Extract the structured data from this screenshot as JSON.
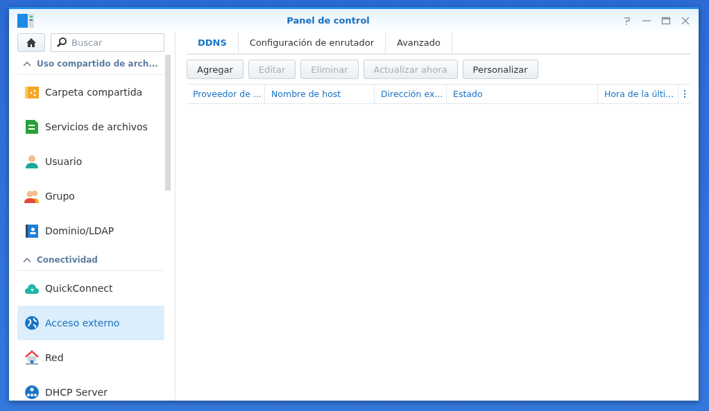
{
  "window": {
    "title": "Panel de control"
  },
  "sidebar": {
    "search": {
      "placeholder": "Buscar"
    },
    "groups": [
      {
        "title": "Uso compartido de arch...",
        "expanded": true,
        "items": [
          {
            "label": "Carpeta compartida",
            "selected": false
          },
          {
            "label": "Servicios de archivos",
            "selected": false
          },
          {
            "label": "Usuario",
            "selected": false
          },
          {
            "label": "Grupo",
            "selected": false
          },
          {
            "label": "Dominio/LDAP",
            "selected": false
          }
        ]
      },
      {
        "title": "Conectividad",
        "expanded": true,
        "items": [
          {
            "label": "QuickConnect",
            "selected": false
          },
          {
            "label": "Acceso externo",
            "selected": true
          },
          {
            "label": "Red",
            "selected": false
          },
          {
            "label": "DHCP Server",
            "selected": false
          }
        ]
      }
    ]
  },
  "tabs": [
    {
      "label": "DDNS",
      "selected": true
    },
    {
      "label": "Configuración de enrutador",
      "selected": false
    },
    {
      "label": "Avanzado",
      "selected": false
    }
  ],
  "toolbar": [
    {
      "label": "Agregar",
      "disabled": false
    },
    {
      "label": "Editar",
      "disabled": true
    },
    {
      "label": "Eliminar",
      "disabled": true
    },
    {
      "label": "Actualizar ahora",
      "disabled": true
    },
    {
      "label": "Personalizar",
      "disabled": false
    }
  ],
  "table": {
    "columns": [
      "Proveedor de ...",
      "Nombre de host",
      "Dirección ex...",
      "Estado",
      "Hora de la últi..."
    ]
  }
}
